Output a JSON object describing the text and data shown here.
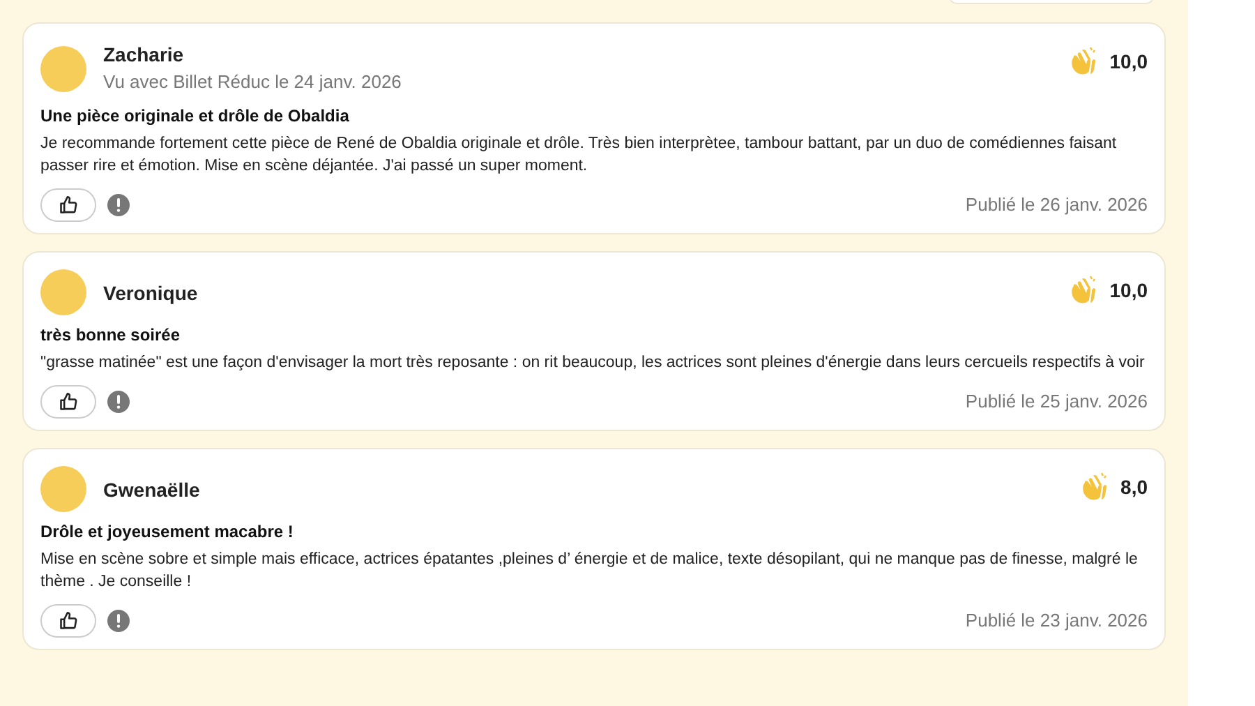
{
  "reviews": [
    {
      "author": "Zacharie",
      "seen_with": "Vu avec Billet Réduc le 24 janv. 2026",
      "score": "10,0",
      "title": "Une pièce originale et drôle de Obaldia",
      "body": "Je recommande fortement cette pièce de René de Obaldia originale et drôle. Très bien interprètee, tambour battant, par un duo de comédiennes faisant passer rire et émotion. Mise en scène déjantée. J'ai passé un super moment.",
      "published": "Publié le 26 janv. 2026"
    },
    {
      "author": "Veronique",
      "score": "10,0",
      "title": "très bonne soirée",
      "body": "\"grasse matinée\" est une façon d'envisager la mort très reposante : on rit beaucoup, les actrices sont pleines d'énergie dans leurs cercueils respectifs à voir",
      "published": "Publié le 25 janv. 2026"
    },
    {
      "author": "Gwenaëlle",
      "score": "8,0",
      "title": "Drôle et joyeusement macabre !",
      "body": "Mise en scène sobre et simple mais efficace, actrices épatantes ,pleines d’ énergie et de malice, texte désopilant, qui ne manque pas de finesse, malgré le thème . Je conseille !",
      "published": "Publié le 23 janv. 2026"
    }
  ]
}
